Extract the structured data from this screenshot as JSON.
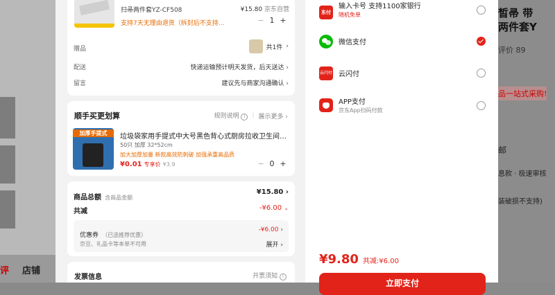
{
  "background": {
    "left_tabs": [
      "评",
      "店铺"
    ],
    "right_texts": [
      "皙帚 带",
      "两件套Y",
      "评价 89",
      "品一站式采购!",
      "邮",
      "息款 · 极速审核",
      "装破损不支持)"
    ]
  },
  "product": {
    "name": "扫帚两件套YZ-CF508",
    "price": "¥15.80",
    "seller": "京东自营",
    "return_policy": "支持7天无理由退货（拆封后不支持…",
    "quantity": "1"
  },
  "order_rows": [
    {
      "label": "赠品",
      "value": "共1件"
    },
    {
      "label": "配送",
      "value": "快递运输预计明天发货，后天送达"
    },
    {
      "label": "留言",
      "value": "建议先与商家沟通确认"
    }
  ],
  "addon": {
    "title": "顺手买更划算",
    "rules": "规则说明",
    "more": "展示更多",
    "item_name": "垃圾袋家用手提式中大号黑色背心式厨房拉收卫生间…",
    "spec": "50只 加厚 32*52cm",
    "tags": "加大加厚加量 新款高效防刺破 加强承重高品质",
    "price": "¥0.01",
    "price_label": "专享价",
    "orig_price": "¥3.9",
    "quantity": "0",
    "thumb_text": "加厚手提式"
  },
  "summary": {
    "total_label": "商品总额",
    "total_sub": "含商品金额",
    "total_value": "¥15.80",
    "discount_label": "共减",
    "discount_value": "-¥6.00",
    "coupon_label": "优惠券",
    "coupon_sub": "（已选推荐优惠）",
    "coupon_value": "-¥6.00",
    "card_note": "京豆、礼品卡等本单不可用",
    "expand": "展开"
  },
  "invoice": {
    "title": "发票信息",
    "note": "开票须知"
  },
  "payment": {
    "methods": [
      {
        "title": "输入卡号 支持1100家银行",
        "sub": "随机免单",
        "icon_text": "东付",
        "selected": false
      },
      {
        "title": "微信支付",
        "sub": "",
        "icon_text": "",
        "selected": true
      },
      {
        "title": "云闪付",
        "sub": "",
        "icon_text": "云闪付",
        "selected": false
      },
      {
        "title": "APP支付",
        "sub": "京东App扫码付款",
        "icon_text": "",
        "selected": false
      }
    ],
    "total": "¥9.80",
    "saved": "共减:¥6.00",
    "submit": "立即支付"
  },
  "colors": {
    "accent": "#e2231a",
    "wechat": "#09bb07",
    "orange": "#e66a00"
  }
}
